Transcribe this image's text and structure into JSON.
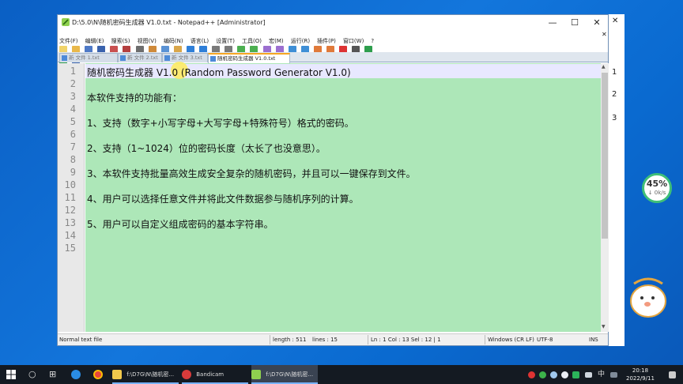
{
  "window": {
    "title": "D:\\5.0\\N\\随机密码生成器 V1.0.txt - Notepad++ [Administrator]",
    "minimize": "—",
    "maximize": "☐",
    "close": "✕",
    "overflow_close": "✕"
  },
  "menu": [
    "文件(F)",
    "编辑(E)",
    "搜索(S)",
    "视图(V)",
    "编码(N)",
    "语言(L)",
    "设置(T)",
    "工具(O)",
    "宏(M)",
    "运行(R)",
    "插件(P)",
    "窗口(W)",
    "?"
  ],
  "tabs": [
    {
      "label": "新 文件 1.txt",
      "active": false
    },
    {
      "label": "新 文件 2.txt",
      "active": false
    },
    {
      "label": "新 文件 3.txt",
      "active": false
    },
    {
      "label": "随机密码生成器 V1.0.txt",
      "active": true
    }
  ],
  "editor": {
    "line_numbers": [
      "1",
      "2",
      "3",
      "4",
      "5",
      "6",
      "7",
      "8",
      "9",
      "10",
      "11",
      "12",
      "13",
      "14",
      "15"
    ],
    "lines": [
      "随机密码生成器 V1.0 (Random Password Generator V1.0)",
      "",
      "本软件支持的功能有：",
      "",
      "1、支持（数字+小写字母+大写字母+特殊符号）格式的密码。",
      "",
      "2、支持（1~1024）位的密码长度（太长了也没意思）。",
      "",
      "3、本软件支持批量高效生成安全复杂的随机密码，并且可以一键保存到文件。",
      "",
      "4、用户可以选择任意文件并将此文件数据参与随机序列的计算。",
      "",
      "5、用户可以自定义组成密码的基本字符串。",
      "",
      ""
    ]
  },
  "status": {
    "type": "Normal text file",
    "length": "length : 511",
    "lines": "lines : 15",
    "position": "Ln : 1    Col : 13    Sel : 12 | 1",
    "eol": "Windows (CR LF)",
    "encoding": "UTF-8",
    "mode": "INS"
  },
  "desktop": {
    "gauge_value": "45%",
    "gauge_unit": "↓ 0k/s",
    "side_controls": [
      "✕",
      "1",
      "2",
      "3"
    ]
  },
  "taskbar": {
    "tasks": [
      "f:\\D7G\\N\\随机密...",
      "Bandicam",
      "f:\\D7G\\N\\随机密..."
    ],
    "search_glyph": "○",
    "taskview_glyph": "⊞",
    "ime": "中",
    "time": "20:18",
    "date": "2022/9/11"
  }
}
